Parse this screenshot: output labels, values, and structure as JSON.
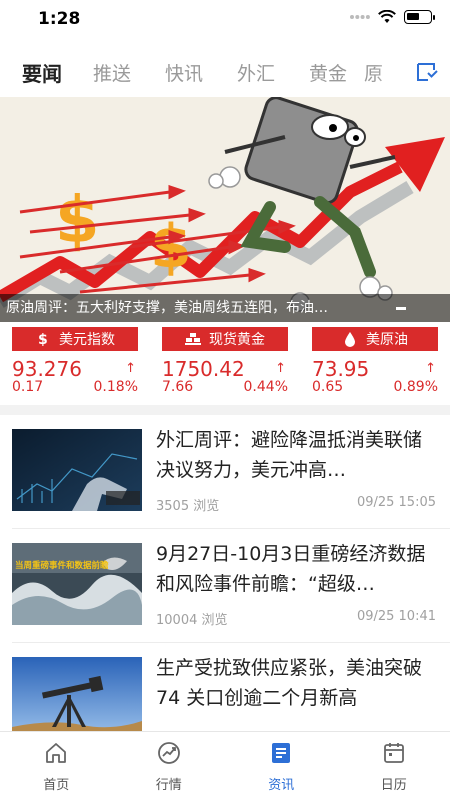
{
  "status_bar": {
    "time": "1:28"
  },
  "tabs": [
    {
      "label": "要闻",
      "active": true
    },
    {
      "label": "推送",
      "active": false
    },
    {
      "label": "快讯",
      "active": false
    },
    {
      "label": "外汇",
      "active": false
    },
    {
      "label": "黄金",
      "active": false
    },
    {
      "label": "原",
      "active": false
    }
  ],
  "banner": {
    "caption": "原油周评：五大利好支撑，美油周线五连阳，布油…",
    "image_icon": "falling-oil-barrel-illustration"
  },
  "tickers": [
    {
      "name": "美元指数",
      "icon": "dollar-icon",
      "price": "93.276",
      "change": "0.17",
      "percent": "0.18%",
      "arrow": "↑"
    },
    {
      "name": "现货黄金",
      "icon": "gold-bars-icon",
      "price": "1750.42",
      "change": "7.66",
      "percent": "0.44%",
      "arrow": "↑"
    },
    {
      "name": "美原油",
      "icon": "oil-drop-icon",
      "price": "73.95",
      "change": "0.65",
      "percent": "0.89%",
      "arrow": "↑"
    }
  ],
  "news": [
    {
      "title": "外汇周评：避险降温抵消美联储决议努力，美元冲高…",
      "views": "3505 浏览",
      "time": "09/25 15:05"
    },
    {
      "title": "9月27日-10月3日重磅经济数据和风险事件前瞻：“超级…",
      "views": "10004 浏览",
      "time": "09/25 10:41",
      "thumb_text": "当周重磅事件和数据前瞻"
    },
    {
      "title": "生产受扰致供应紧张，美油突破 74 关口创逾二个月新高",
      "views": "",
      "time": ""
    }
  ],
  "nav": [
    {
      "label": "首页",
      "icon": "home-icon",
      "active": false
    },
    {
      "label": "行情",
      "icon": "market-chart-icon",
      "active": false
    },
    {
      "label": "资讯",
      "icon": "news-icon",
      "active": true
    },
    {
      "label": "日历",
      "icon": "calendar-icon",
      "active": false
    }
  ],
  "colors": {
    "accent_red": "#d92b2b",
    "active_blue": "#2d6fd6",
    "muted": "#9a9a9a"
  },
  "battery_level": 0.55
}
